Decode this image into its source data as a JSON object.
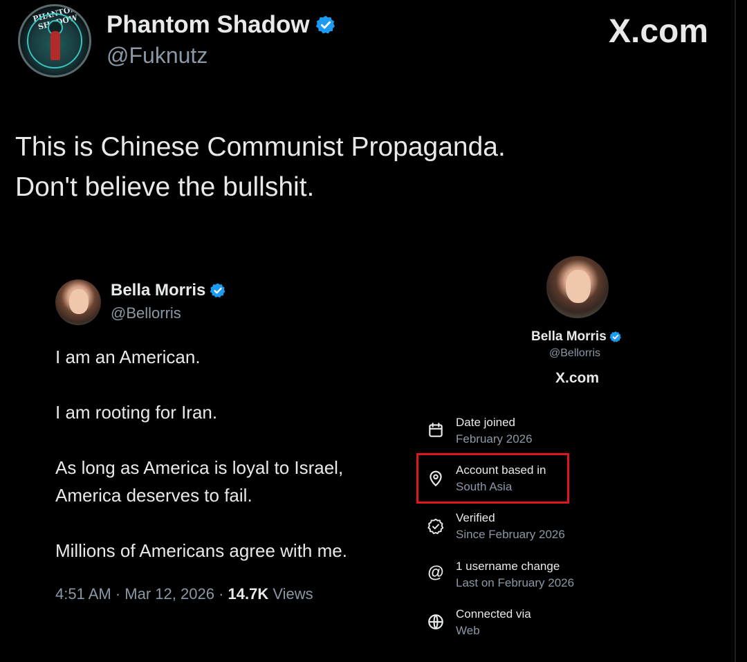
{
  "post": {
    "author_name": "Phantom Shadow",
    "author_handle": "@Fuknutz",
    "avatar_text": "PHANTOM SHADOW",
    "brand": "X.com",
    "text_line1": "This is Chinese Communist Propaganda.",
    "text_line2": "Don't believe the bullshit."
  },
  "quoted_post": {
    "author_name": "Bella Morris",
    "author_handle": "@Bellorris",
    "lines": [
      "I am an American.",
      "I am rooting for Iran.",
      "As long as America is loyal to Israel,",
      "America deserves to fail.",
      "Millions of Americans agree with me."
    ],
    "time": "4:51 AM",
    "date": "Mar 12, 2026",
    "views_count": "14.7K",
    "views_label": "Views"
  },
  "account_info": {
    "name": "Bella Morris",
    "handle": "@Bellorris",
    "brand": "X.com",
    "items": [
      {
        "icon": "calendar-icon",
        "label": "Date joined",
        "value": "February 2026"
      },
      {
        "icon": "location-icon",
        "label": "Account based in",
        "value": "South Asia",
        "highlighted": true
      },
      {
        "icon": "verified-badge-icon",
        "label": "Verified",
        "value": "Since February 2026"
      },
      {
        "icon": "at-icon",
        "label": "1 username change",
        "value": "Last on February 2026"
      },
      {
        "icon": "globe-icon",
        "label": "Connected via",
        "value": "Web"
      }
    ]
  },
  "colors": {
    "background": "#000000",
    "text_primary": "#e7e9ea",
    "text_secondary": "#8b98a5",
    "verified_blue": "#1d9bf0",
    "highlight_red": "#e0161d"
  }
}
